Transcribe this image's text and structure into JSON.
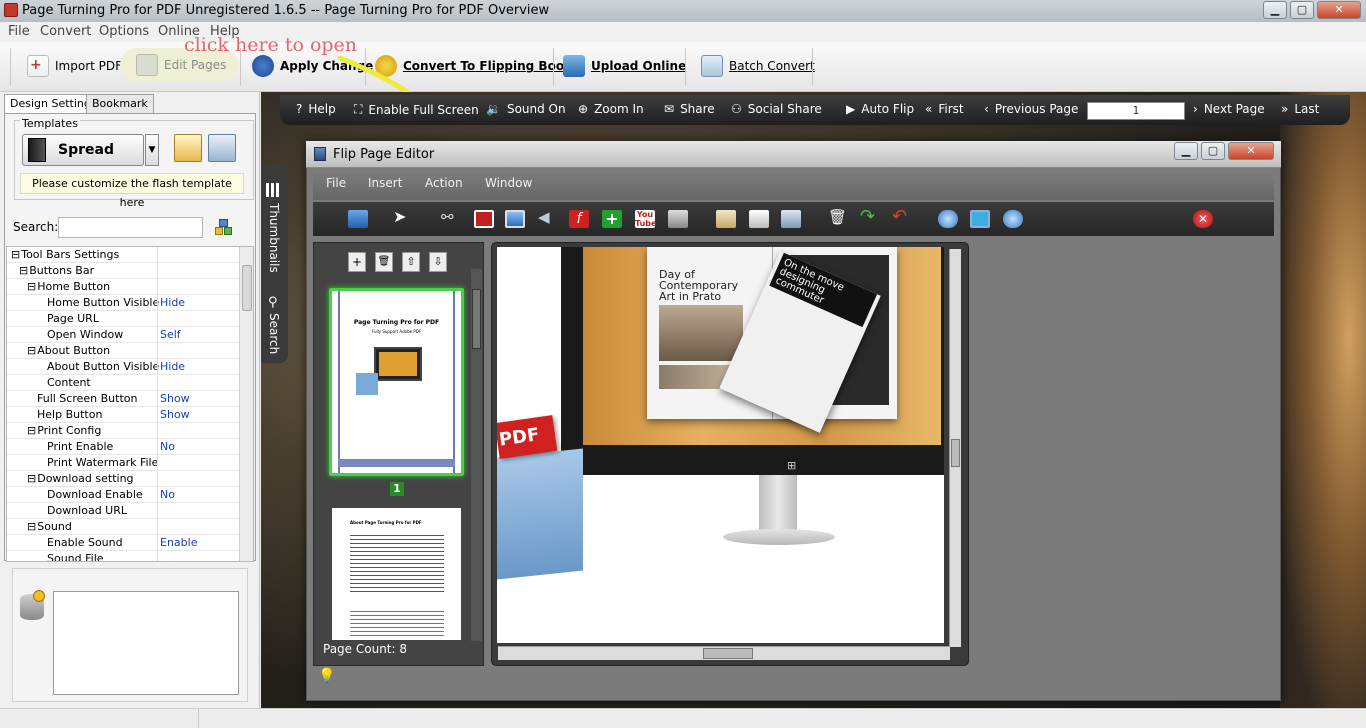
{
  "window": {
    "title": "Page Turning Pro for PDF Unregistered 1.6.5  -- Page Turning Pro for PDF Overview"
  },
  "menu": [
    "File",
    "Convert",
    "Options",
    "Online",
    "Help"
  ],
  "toolbar": {
    "import": "Import PDF",
    "edit": "Edit Pages",
    "apply": "Apply Change",
    "convert": "Convert To Flipping Book",
    "upload": "Upload Online",
    "batch": "Batch Convert"
  },
  "hint": "click here to open",
  "panel": {
    "tabs": [
      "Design Setting",
      "Bookmark"
    ],
    "templates_label": "Templates",
    "template_button": "Spread",
    "template_note": "Please customize the flash template here",
    "search_label": "Search:"
  },
  "settings": [
    {
      "name": "Tool Bars Settings",
      "value": "",
      "level": 0,
      "group": true
    },
    {
      "name": "Buttons Bar",
      "value": "",
      "level": 1,
      "group": true
    },
    {
      "name": "Home Button",
      "value": "",
      "level": 2,
      "group": true
    },
    {
      "name": "Home Button Visible",
      "value": "Hide",
      "level": 3
    },
    {
      "name": "Page URL",
      "value": "",
      "level": 3
    },
    {
      "name": "Open Window",
      "value": "Self",
      "level": 3
    },
    {
      "name": "About Button",
      "value": "",
      "level": 2,
      "group": true
    },
    {
      "name": "About Button Visible",
      "value": "Hide",
      "level": 3
    },
    {
      "name": "Content",
      "value": "",
      "level": 3
    },
    {
      "name": "Full Screen Button",
      "value": "Show",
      "level": 2
    },
    {
      "name": "Help Button",
      "value": "Show",
      "level": 2
    },
    {
      "name": "Print Config",
      "value": "",
      "level": 2,
      "group": true
    },
    {
      "name": "Print Enable",
      "value": "No",
      "level": 3
    },
    {
      "name": "Print Watermark File",
      "value": "",
      "level": 3
    },
    {
      "name": "Download setting",
      "value": "",
      "level": 2,
      "group": true
    },
    {
      "name": "Download Enable",
      "value": "No",
      "level": 3
    },
    {
      "name": "Download URL",
      "value": "",
      "level": 3
    },
    {
      "name": "Sound",
      "value": "",
      "level": 2,
      "group": true
    },
    {
      "name": "Enable Sound",
      "value": "Enable",
      "level": 3
    },
    {
      "name": "Sound File",
      "value": "",
      "level": 3
    }
  ],
  "player": {
    "help": "Help",
    "fullscreen": "Enable Full Screen",
    "sound": "Sound On",
    "zoom": "Zoom In",
    "share": "Share",
    "social": "Social Share",
    "autoflip": "Auto Flip",
    "first": "First",
    "prev": "Previous Page",
    "page": "1",
    "next": "Next Page",
    "last": "Last",
    "side_thumbnails": "Thumbnails",
    "side_search": "Search"
  },
  "editor": {
    "title": "Flip Page Editor",
    "menu": [
      "File",
      "Insert",
      "Action",
      "Window"
    ],
    "page_count": "Page Count: 8",
    "thumb_label": "1",
    "thumb1": {
      "title": "Page Turning Pro for PDF",
      "subtitle": "Fully Support Adobe PDF"
    },
    "thumb2": {
      "title": "About Page Turning Pro for PDF"
    },
    "page": {
      "magazine_title": "Day of Contemporary Art in Prato",
      "pdf_label": "PDF",
      "cover_text": "On the move designing commuter"
    }
  },
  "colors": {
    "accent": "#1a3fb3",
    "hint": "#e8636e",
    "thumb_border": "#48d048"
  }
}
